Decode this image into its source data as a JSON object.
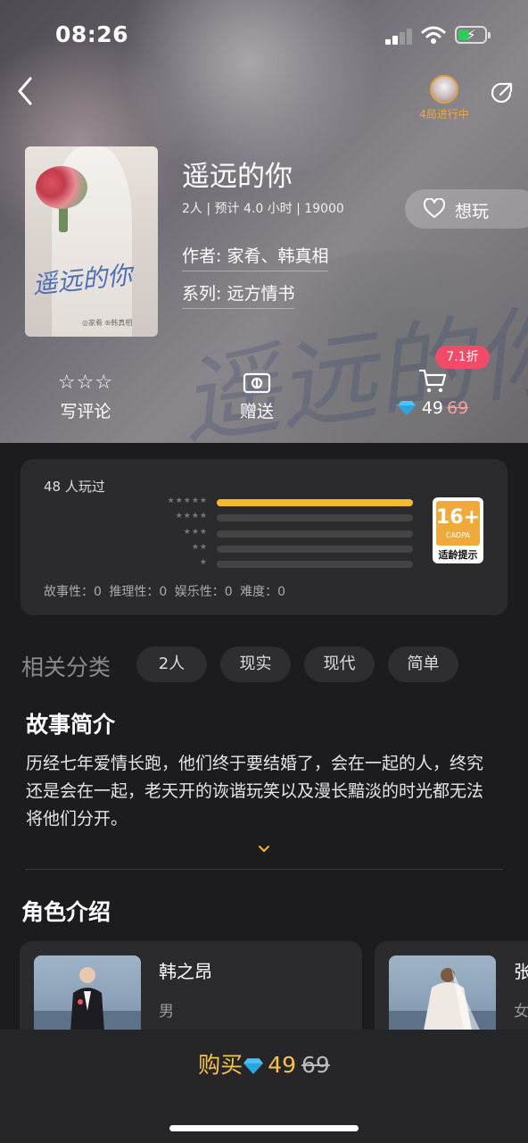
{
  "status_bar": {
    "time": "08:26"
  },
  "header": {
    "playing_label": "4局进行中"
  },
  "game": {
    "title": "遥远的你",
    "meta": "2人 | 预计 4.0 小时 | 19000",
    "author": "作者: 家肴、韩真相",
    "series": "系列: 远方情书",
    "cover_title": "遥远的你",
    "cover_sub": "◎家肴 ⊛韩真相"
  },
  "want_button": {
    "label": "想玩",
    "icon": "heart-icon"
  },
  "actions": {
    "review": {
      "label": "写评论",
      "icon": "star-outline-icon"
    },
    "gift": {
      "label": "赠送",
      "icon": "gift-icon"
    },
    "buy": {
      "icon": "cart-icon",
      "price": "49",
      "original_price": "69",
      "discount_badge": "7.1折"
    }
  },
  "rating": {
    "played_count": "48 人玩过",
    "distribution": [
      {
        "stars": "★★★★★",
        "fraction": 1.0
      },
      {
        "stars": "★★★★",
        "fraction": 0
      },
      {
        "stars": "★★★",
        "fraction": 0
      },
      {
        "stars": "★★",
        "fraction": 0
      },
      {
        "stars": "★",
        "fraction": 0
      }
    ],
    "dimensions": "故事性：0  推理性：0  娱乐性：0  难度：0",
    "age_badge": {
      "rating": "16+",
      "org": "CADPA",
      "caption": "适龄提示"
    }
  },
  "categories": {
    "title": "相关分类",
    "tags": [
      "2人",
      "现实",
      "现代",
      "简单"
    ]
  },
  "story": {
    "title": "故事简介",
    "text": "历经七年爱情长跑，他们终于要结婚了，会在一起的人，终究还是会在一起，老天开的诙谐玩笑以及漫长黯淡的时光都无法将他们分开。"
  },
  "characters": {
    "title": "角色介绍",
    "list": [
      {
        "name": "韩之昂",
        "gender": "男"
      },
      {
        "name": "张",
        "gender": "女"
      }
    ]
  },
  "bottom": {
    "buy_label": "购买",
    "price": "49",
    "original_price": "69"
  },
  "colors": {
    "accent": "#f5b92b",
    "discount": "#f24b6a",
    "buy_text": "#f5c24a",
    "background": "#1c1c1e"
  }
}
